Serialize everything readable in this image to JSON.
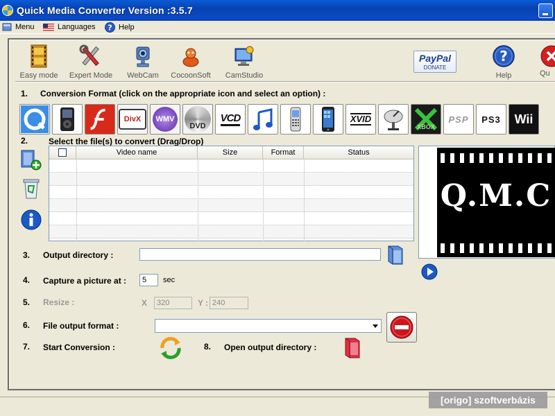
{
  "window": {
    "title": "Quick Media Converter   Version :3.5.7"
  },
  "menu": {
    "items": [
      {
        "label": "Menu",
        "icon": "app-menu-icon"
      },
      {
        "label": "Languages",
        "icon": "us-flag-icon"
      },
      {
        "label": "Help",
        "icon": "help-question-icon"
      }
    ]
  },
  "toolbar": {
    "easy": "Easy mode",
    "expert": "Expert Mode",
    "webcam": "WebCam",
    "cocoonsoft": "CocoonSoft",
    "camstudio": "CamStudio",
    "paypal": "PayPal",
    "paypal_sub": "DONATE",
    "help": "Help",
    "quit": "Qu"
  },
  "step1": {
    "num": "1.",
    "label": "Conversion Format (click on the appropriate icon and select an option) :"
  },
  "formats": [
    "QuickTime",
    "iPod",
    "Flash",
    "DivX",
    "WMV",
    "DVD",
    "VCD",
    "Music",
    "Mobile",
    "iPhone",
    "XviD",
    "Satellite",
    "XBOX",
    "PSP",
    "PS3",
    "Wii"
  ],
  "format_texts": {
    "divx": "DivX",
    "wmv": "WMV",
    "dvd": "DVD",
    "vcd": "VCD",
    "xvid": "XVID",
    "xbox": "XBOX",
    "psp": "PSP",
    "ps3": "PS3",
    "wii": "Wii"
  },
  "step2": {
    "num": "2.",
    "label": "Select the  file(s) to convert (Drag/Drop)"
  },
  "table": {
    "headers": [
      "Video name",
      "Size",
      "Format",
      "Status"
    ]
  },
  "preview": {
    "text": "Q.M.C"
  },
  "step3": {
    "num": "3.",
    "label": "Output directory :",
    "value": ""
  },
  "step4": {
    "num": "4.",
    "label": "Capture a picture at :",
    "value": "5",
    "unit": "sec"
  },
  "step5": {
    "num": "5.",
    "label": "Resize :",
    "x_label": "X",
    "x_value": "320",
    "y_label": "Y :",
    "y_value": "240"
  },
  "step6": {
    "num": "6.",
    "label": "File output format :",
    "value": ""
  },
  "step7": {
    "num": "7.",
    "label": "Start Conversion :"
  },
  "step8": {
    "num": "8.",
    "label": "Open output directory :"
  },
  "watermark": "[origo] szoftverbázis",
  "colors": {
    "titlebar": "#0a4bc8",
    "accent": "#1c58d6",
    "stop": "#d0141c"
  }
}
